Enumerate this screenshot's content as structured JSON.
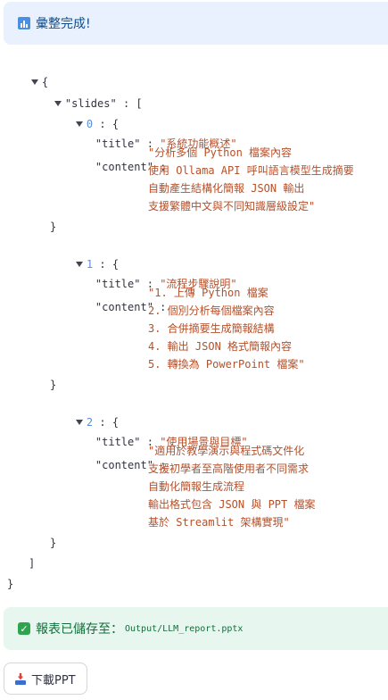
{
  "info_banner": {
    "icon": "bar-chart-icon",
    "text": "彙整完成!"
  },
  "json": {
    "root_open": "{",
    "slides_key": "\"slides\"",
    "colon": ":",
    "array_open": "[",
    "array_close": "]",
    "root_close": "}",
    "title_key": "\"title\"",
    "content_key": "\"content\"",
    "obj_open": "{",
    "obj_close": "}",
    "slides": [
      {
        "index": "0",
        "title": "\"系統功能概述\"",
        "content_lines": [
          "\"分析多個 Python 檔案內容",
          "使用 Ollama API 呼叫語言模型生成摘要",
          "自動產生結構化簡報 JSON 輸出",
          "支援繁體中文與不同知識層級設定\""
        ]
      },
      {
        "index": "1",
        "title": "\"流程步驟說明\"",
        "content_lines": [
          "\"1. 上傳 Python 檔案",
          "2. 個別分析每個檔案內容",
          "3. 合併摘要生成簡報結構",
          "4. 輸出 JSON 格式簡報內容",
          "5. 轉換為 PowerPoint 檔案\""
        ]
      },
      {
        "index": "2",
        "title": "\"使用場景與目標\"",
        "content_lines": [
          "\"適用於教學演示與程式碼文件化",
          "支援初學者至高階使用者不同需求",
          "自動化簡報生成流程",
          "輸出格式包含 JSON 與 PPT 檔案",
          "基於 Streamlit 架構實現\""
        ]
      }
    ]
  },
  "success_banner": {
    "icon": "check-icon",
    "text": "報表已儲存至：",
    "path": "Output/LLM_report.pptx"
  },
  "download_button": {
    "icon": "download-icon",
    "label": "下載PPT"
  }
}
